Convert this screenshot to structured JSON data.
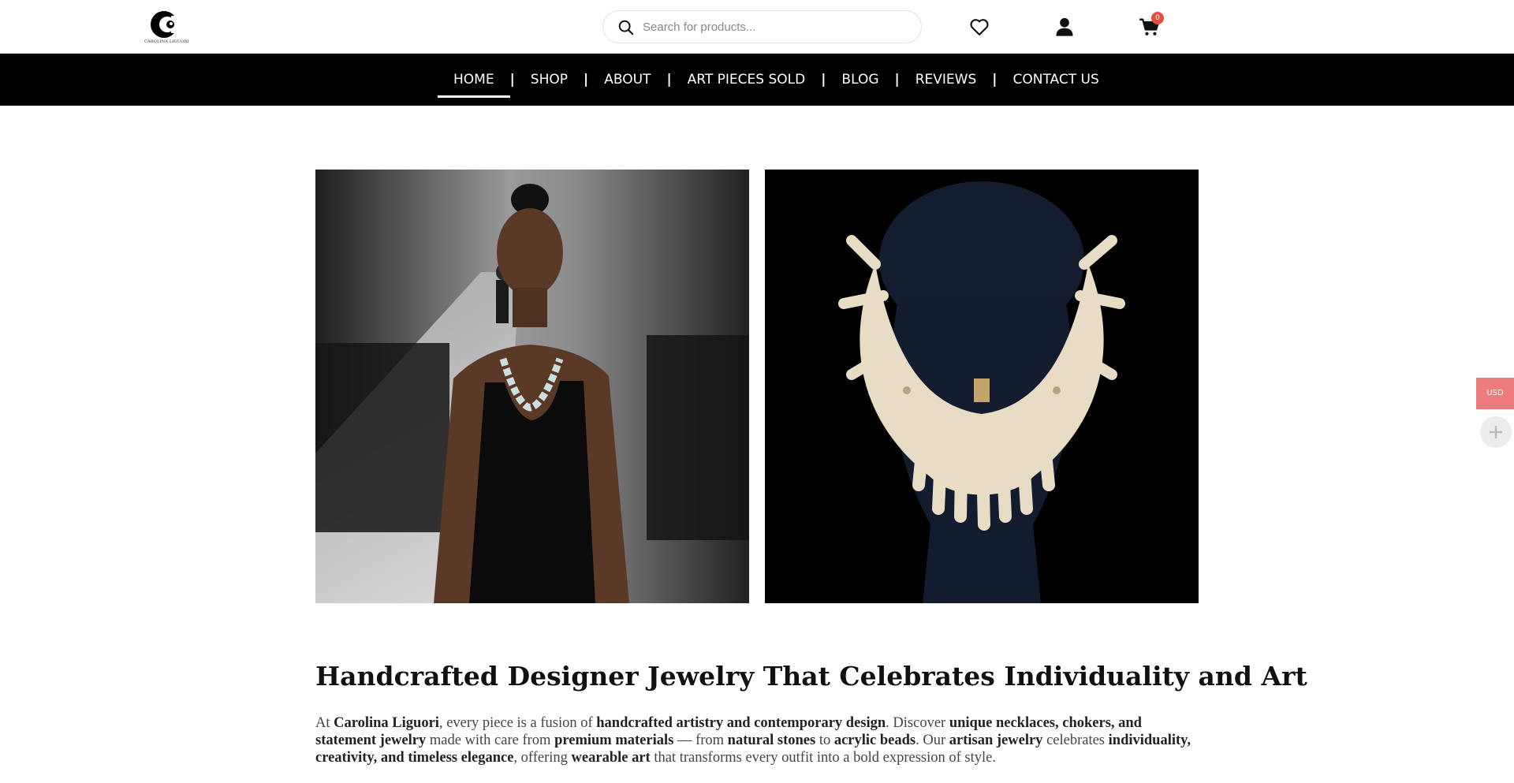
{
  "brand": {
    "logo_text": "CAROLINA LIGUORI"
  },
  "search": {
    "placeholder": "Search for products..."
  },
  "header": {
    "cart_count": "0"
  },
  "nav": {
    "items": [
      "HOME",
      "SHOP",
      "ABOUT",
      "ART PIECES SOLD",
      "BLOG",
      "REVIEWS",
      "CONTACT US"
    ],
    "separator": "|",
    "active": "HOME"
  },
  "icons": {
    "search": "search-icon",
    "wishlist": "heart-icon",
    "account": "user-icon",
    "cart": "cart-icon",
    "plus": "plus-icon"
  },
  "hero": {
    "headline": "Handcrafted Designer Jewelry That Celebrates Individuality and Art",
    "intro": {
      "t1": "At ",
      "b1": "Carolina Liguori",
      "t2": ", every piece is a fusion of ",
      "b2": "handcrafted artistry and contemporary design",
      "t3": ". Discover ",
      "b3": "unique necklaces, chokers, and statement jewelry",
      "t4": " made with care from ",
      "b4": "premium materials",
      "t5": " — from ",
      "b5": "natural stones",
      "t6": " to ",
      "b6": "acrylic beads",
      "t7": ". Our ",
      "b7": "artisan jewelry",
      "t8": " celebrates ",
      "b8": "individuality, creativity, and timeless elegance",
      "t9": ", offering ",
      "b9": "wearable art",
      "t10": " that transforms every outfit into a bold expression of style."
    }
  },
  "widgets": {
    "currency": "USD"
  },
  "colors": {
    "nav_bg": "#000000",
    "cart_badge": "#e74c3c",
    "currency_bg": "#ee7c7f"
  }
}
